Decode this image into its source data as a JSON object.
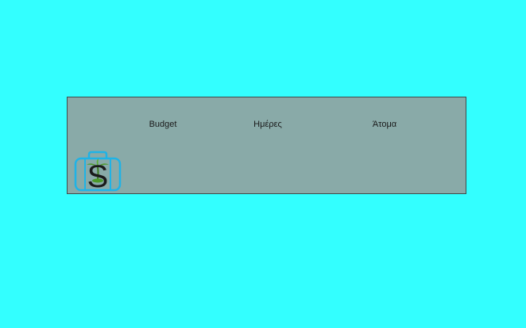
{
  "header": {
    "budget_label": "Budget",
    "days_label": "Ημέρες",
    "people_label": "Άτομα"
  },
  "logo": {
    "icon": "suitcase-palm-logo",
    "letter": "S"
  },
  "colors": {
    "background": "#33ffff",
    "panel": "#89aaa8",
    "panel_border": "#3c4d4d",
    "logo_outline": "#1fb3e6",
    "logo_letter": "#1a1a1a",
    "palm": "#4c9a2a"
  }
}
